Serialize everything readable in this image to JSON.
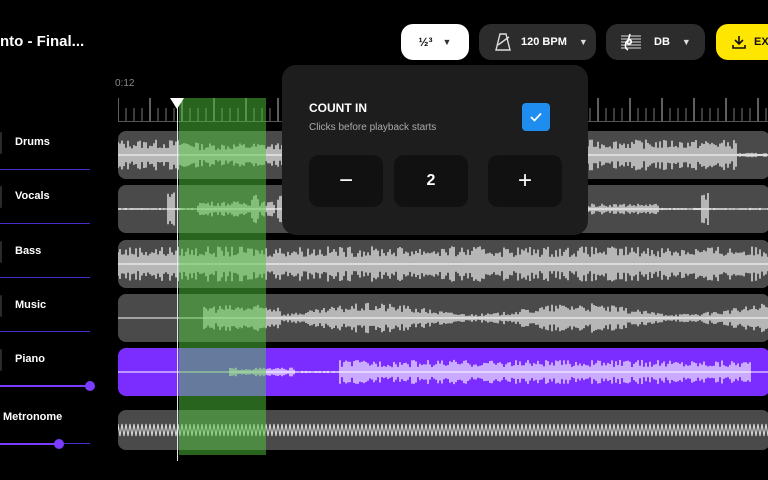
{
  "header": {
    "title": "nto - Final...",
    "count_in_icon_label": "1₂³",
    "bpm_label": "120 BPM",
    "key_label": "DB",
    "export_label": "EX"
  },
  "timeline": {
    "time_label": "0:12"
  },
  "tracks": [
    {
      "label": "Drums",
      "color": "#4a4a4a",
      "wave": "#ffffff"
    },
    {
      "label": "Vocals",
      "color": "#4a4a4a",
      "wave": "#ffffff"
    },
    {
      "label": "Bass",
      "color": "#4a4a4a",
      "wave": "#ffffff"
    },
    {
      "label": "Music",
      "color": "#4a4a4a",
      "wave": "#ffffff"
    },
    {
      "label": "Piano",
      "color": "#7b2dff",
      "wave": "#ffffff"
    },
    {
      "label": "Metronome",
      "color": "#4a4a4a",
      "wave": "#dddddd"
    }
  ],
  "volume": {
    "piano_level": 1.0,
    "metronome_level": 0.65
  },
  "count_in_popup": {
    "title": "COUNT IN",
    "subtitle": "Clicks before playback starts",
    "enabled": true,
    "value": "2",
    "minus_label": "−",
    "plus_label": "+"
  },
  "colors": {
    "accent": "#7a3cff",
    "highlight": "#4fc83c",
    "export": "#ffe600",
    "checkbox": "#1f8df0"
  }
}
